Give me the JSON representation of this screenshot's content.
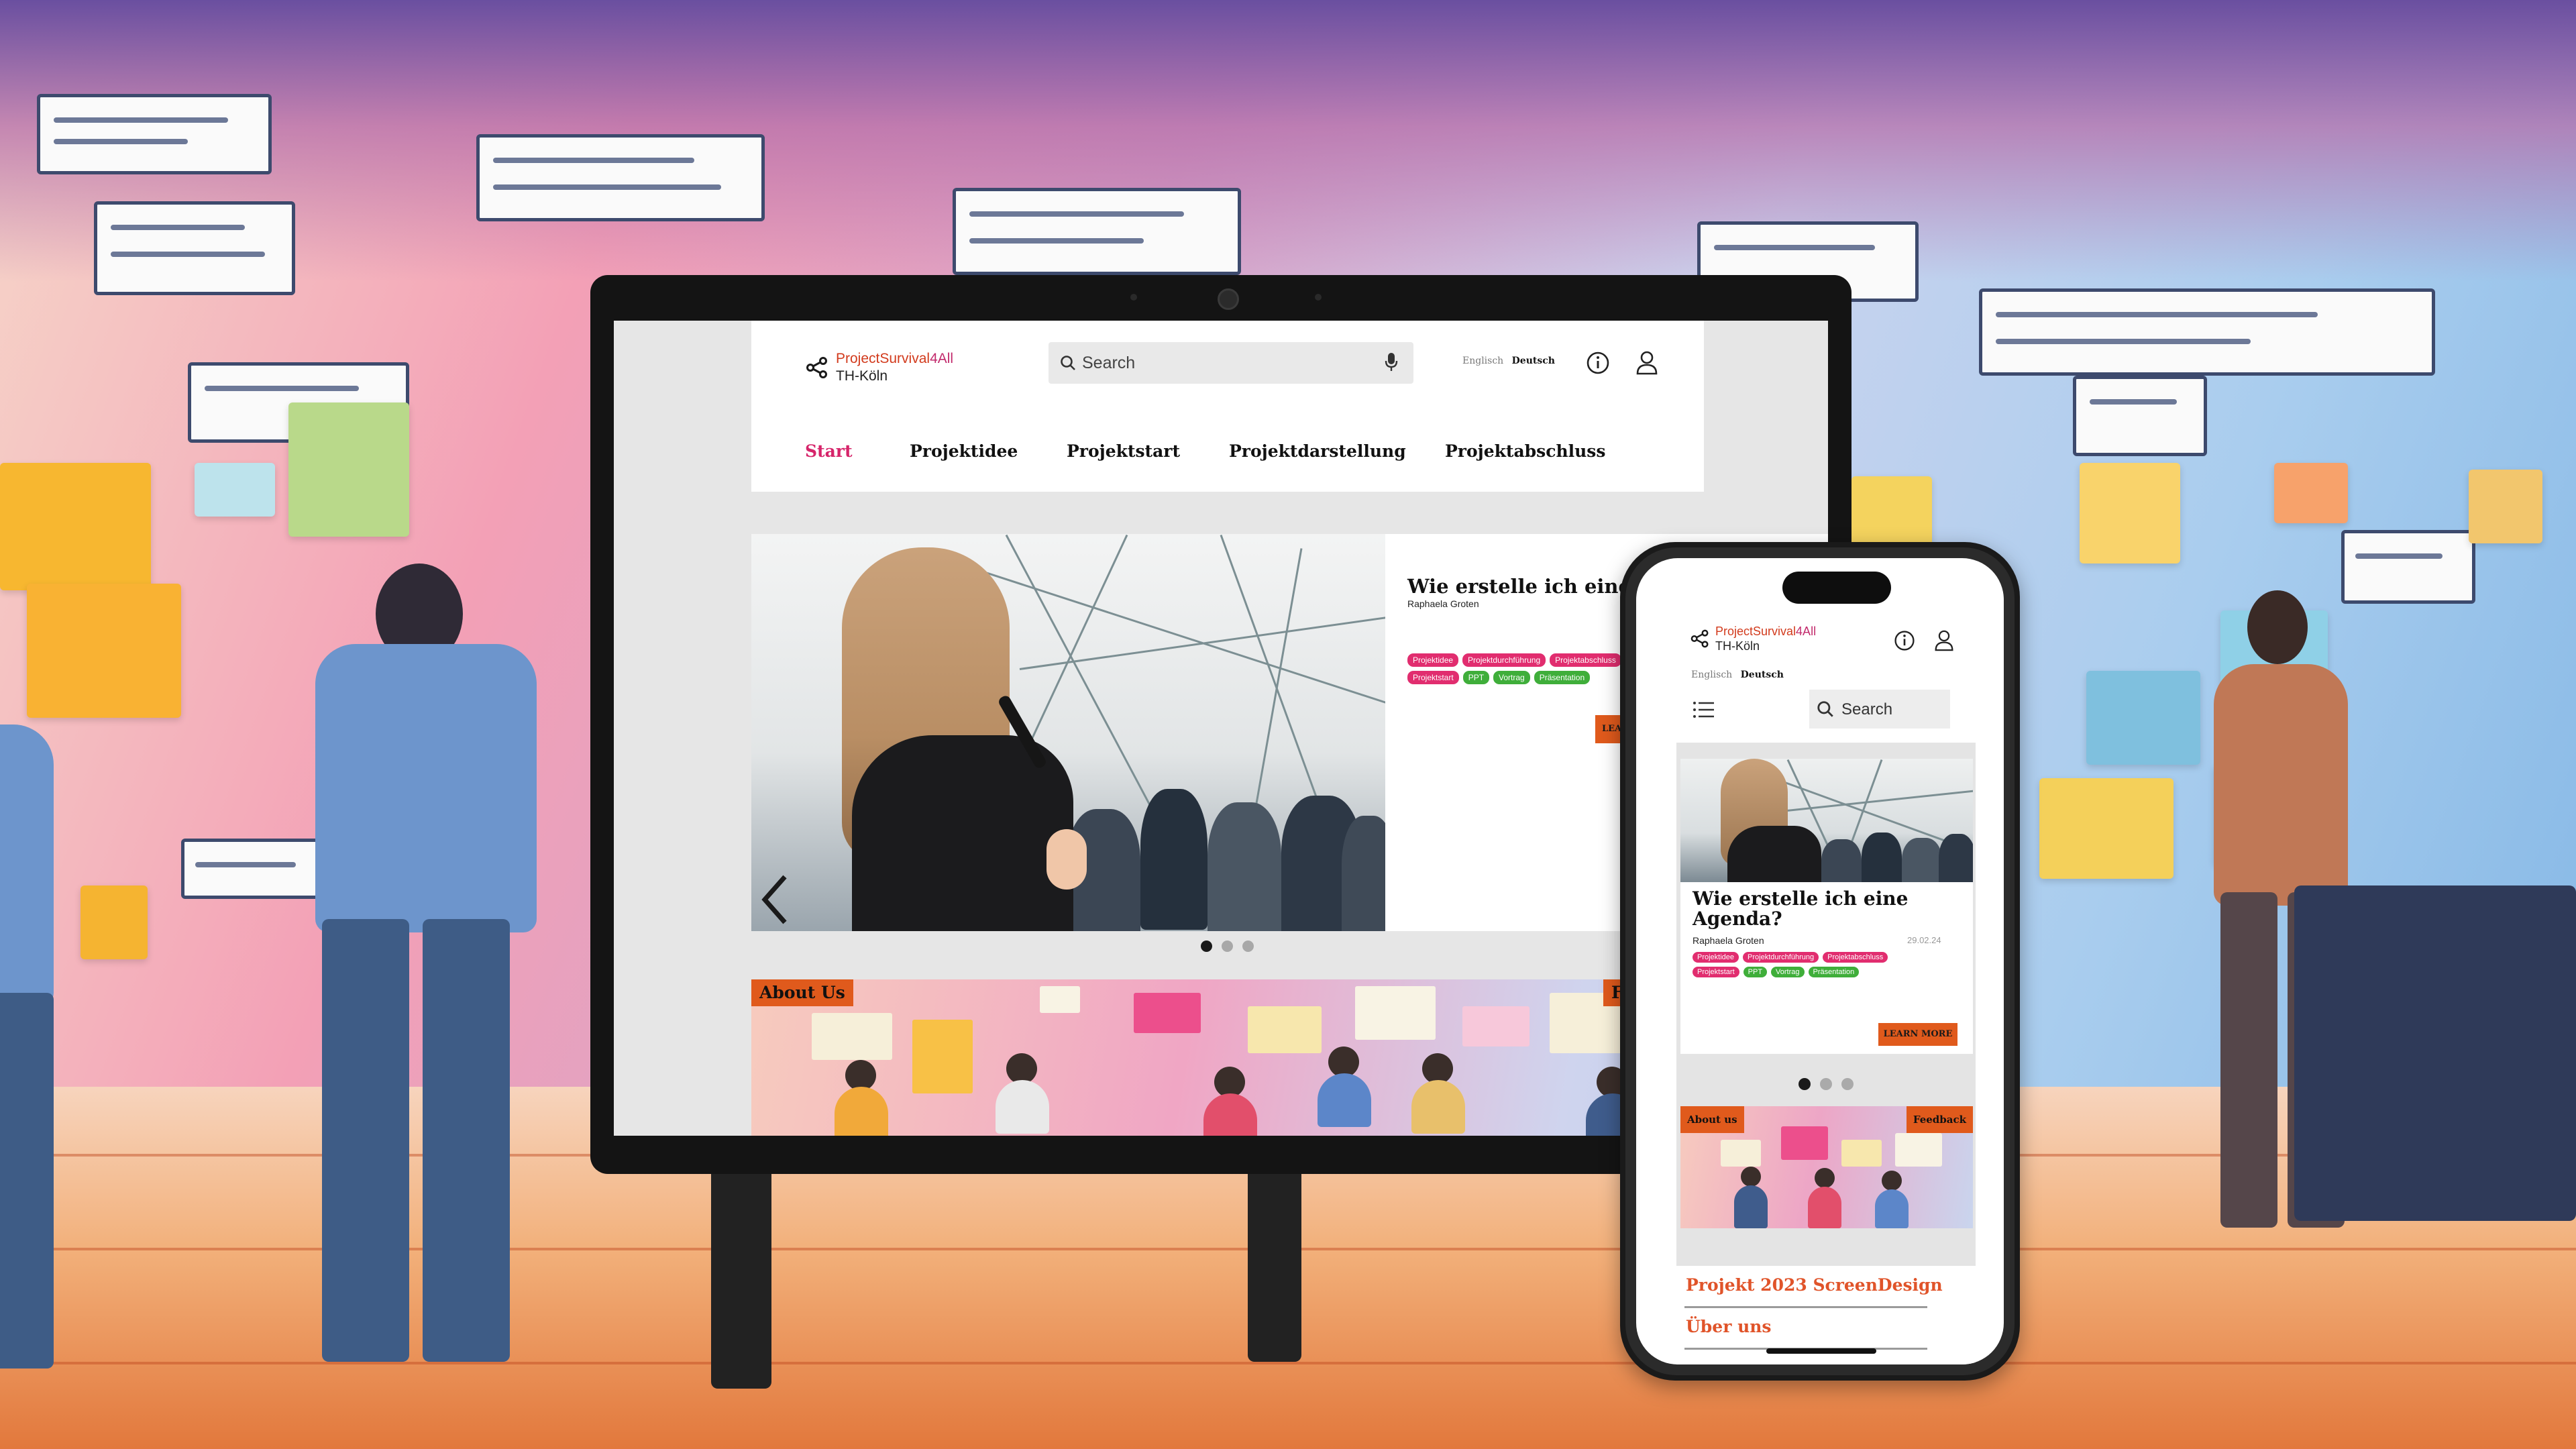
{
  "site": {
    "logo_title": "ProjectSurvival4All",
    "logo_title_part1": "ProjectSurvival",
    "logo_title_part2": "4All",
    "logo_subtitle": "TH-Köln"
  },
  "search": {
    "placeholder": "Search"
  },
  "language": {
    "english": "Englisch",
    "german": "Deutsch",
    "selected": "Deutsch"
  },
  "nav": {
    "items": [
      {
        "label": "Start",
        "active": true
      },
      {
        "label": "Projektidee",
        "active": false
      },
      {
        "label": "Projektstart",
        "active": false
      },
      {
        "label": "Projektdarstellung",
        "active": false
      },
      {
        "label": "Projektabschluss",
        "active": false
      }
    ]
  },
  "hero": {
    "title": "Wie erstelle ich eine Agenda?",
    "author": "Raphaela Groten",
    "date": "29.02.24",
    "tags": [
      {
        "label": "Projektidee",
        "color": "pink"
      },
      {
        "label": "Projektdurchführung",
        "color": "pink"
      },
      {
        "label": "Projektabschluss",
        "color": "pink"
      },
      {
        "label": "Projektstart",
        "color": "pink"
      },
      {
        "label": "PPT",
        "color": "green"
      },
      {
        "label": "Vortrag",
        "color": "green"
      },
      {
        "label": "Präsentation",
        "color": "green"
      }
    ],
    "learn_more": "LEARN MORE",
    "learn_more_desktop_visible": "LEA",
    "slide_current": 1,
    "slide_count": 3
  },
  "banner": {
    "about_desktop": "About Us",
    "about_mobile": "About us",
    "feedback": "Feedback",
    "feedback_desktop_visible": "F"
  },
  "mobile_links": {
    "item1": "Projekt 2023 ScreenDesign",
    "item2": "Über uns"
  },
  "colors": {
    "accent_orange": "#e05a1c",
    "accent_pink": "#e12d6f",
    "tag_green": "#3fae3a",
    "nav_active": "#d6246a",
    "link_orange": "#e0542a"
  },
  "icons": {
    "logo": "share-icon",
    "search": "search-icon",
    "mic": "microphone-icon",
    "info": "info-icon",
    "user": "user-icon",
    "menu": "list-menu-icon",
    "prev": "chevron-left-icon"
  }
}
